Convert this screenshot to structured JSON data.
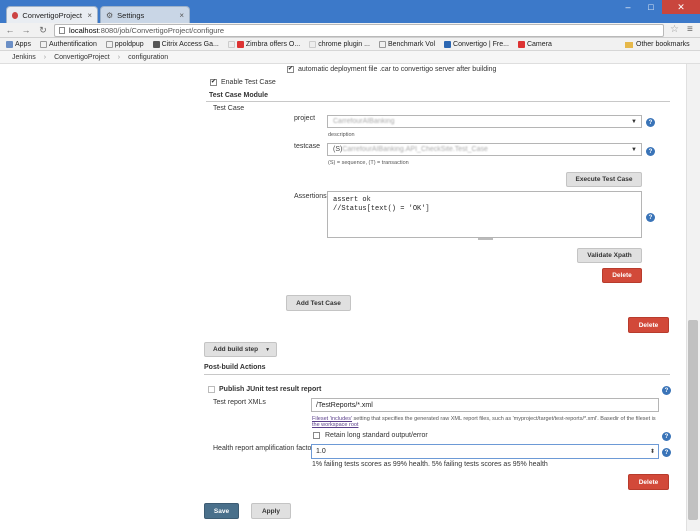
{
  "browser": {
    "tabs": [
      {
        "title": "ConvertigoProject C",
        "active": true
      },
      {
        "title": "Settings",
        "active": false
      }
    ],
    "url_scheme": "",
    "url_host": "localhost",
    "url_path": ":8080/job/ConvertigoProject/configure",
    "bookmarks": [
      "Apps",
      "Authentification",
      "ppoldpup",
      "Citrix Access Ga...",
      "Zimbra offers O...",
      "chrome plugin ...",
      "Benchmark Vol",
      "Convertigo | Fre...",
      "Camera"
    ],
    "other_bookmarks": "Other bookmarks"
  },
  "breadcrumb": [
    "Jenkins",
    "ConvertigoProject",
    "configuration"
  ],
  "form": {
    "auto_deploy_label": "automatic deployment file .car to convertigo server after building",
    "enable_test_case_label": "Enable Test Case",
    "test_case_module_title": "Test Case Module",
    "test_case_label": "Test Case",
    "project_label": "project",
    "project_value": "CarrefourAIBanking",
    "description_label": "description",
    "testcase_label": "testcase",
    "testcase_prefix": "(S)",
    "testcase_value": "CarrefourAIBanking.API_CheckSite.Test_Case",
    "testcase_hint": "(S) = sequence, (T) = transaction",
    "execute_test_case": "Execute Test Case",
    "assertions_label": "Assertions",
    "assertions_value": "assert ok\n//Status[text() = 'OK']",
    "validate_xpath": "Validate Xpath",
    "delete_label": "Delete",
    "add_test_case": "Add Test Case",
    "add_build_step": "Add build step",
    "post_build_actions": "Post-build Actions",
    "publish_junit": "Publish JUnit test result report",
    "test_report_xmls_label": "Test report XMLs",
    "test_report_xmls_value": "/TestReports/*.xml",
    "fileset_link": "Fileset 'includes'",
    "fileset_hint": " setting that specifies the generated raw XML report files, such as 'myproject/target/test-reports/*.xml'. Basedir of the fileset is ",
    "workspace_link": "the workspace root",
    "retain_label": "Retain long standard output/error",
    "health_label": "Health report amplification factor",
    "health_value": "1.0",
    "health_hint": "1% failing tests scores as 99% health. 5% failing tests scores as 95% health",
    "save": "Save",
    "apply": "Apply"
  },
  "colors": {
    "titlebar": "#3c79c9",
    "delete": "#d24939",
    "save": "#4a708b",
    "help": "#3a74b8"
  }
}
